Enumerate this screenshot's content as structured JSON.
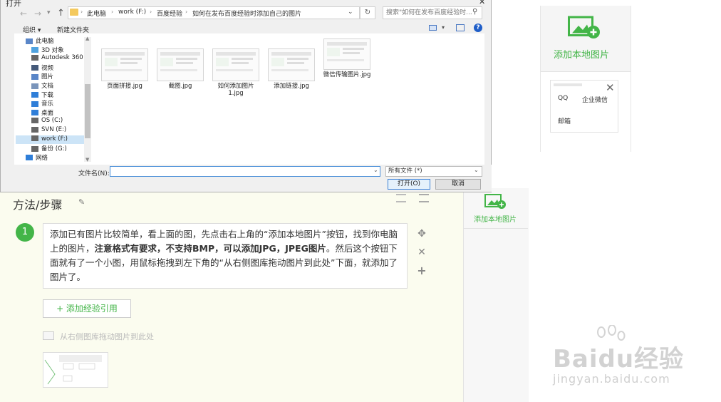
{
  "dialog": {
    "title": "打开",
    "close": "✕",
    "path": [
      "此电脑",
      "work (F:)",
      "百度经验",
      "如何在发布百度经验时添加自己的图片"
    ],
    "search_placeholder": "搜索\"如何在发布百度经验时...",
    "toolbar": {
      "organize": "组织 ▾",
      "new_folder": "新建文件夹"
    },
    "tree": [
      {
        "label": "此电脑",
        "icon": "computer-icon",
        "color": "#5a86c8"
      },
      {
        "label": "3D 对象",
        "icon": "cube-icon",
        "color": "#4fa3e0"
      },
      {
        "label": "Autodesk 360",
        "icon": "cloud-icon",
        "color": "#666"
      },
      {
        "label": "视频",
        "icon": "video-icon",
        "color": "#455a7a"
      },
      {
        "label": "图片",
        "icon": "picture-icon",
        "color": "#5a86c8"
      },
      {
        "label": "文档",
        "icon": "document-icon",
        "color": "#7a95bb"
      },
      {
        "label": "下载",
        "icon": "download-icon",
        "color": "#2f7ed8"
      },
      {
        "label": "音乐",
        "icon": "music-icon",
        "color": "#2f7ed8"
      },
      {
        "label": "桌面",
        "icon": "desktop-icon",
        "color": "#2f7ed8"
      },
      {
        "label": "OS (C:)",
        "icon": "drive-icon",
        "color": "#666"
      },
      {
        "label": "SVN (E:)",
        "icon": "drive-icon",
        "color": "#666"
      },
      {
        "label": "work (F:)",
        "icon": "drive-icon",
        "color": "#666"
      },
      {
        "label": "备份 (G:)",
        "icon": "drive-icon",
        "color": "#666"
      },
      {
        "label": "网络",
        "icon": "network-icon",
        "color": "#2f7ed8"
      }
    ],
    "files": [
      "页面拼接.jpg",
      "截图.jpg",
      "如何添加图片1.jpg",
      "添加链接.jpg",
      "微信传输图片.jpg"
    ],
    "filename_label": "文件名(N):",
    "filename_value": "",
    "filetype": "所有文件 (*)",
    "open_button": "打开(O)",
    "cancel_button": "取消"
  },
  "editor": {
    "section_title": "方法/步骤",
    "step_number": "1",
    "step_text_1": "添加已有图片比较简单，看上面的图，先点击右上角的“添加本地图片”按钮，找到你电脑上的图片，",
    "step_text_bold": "注意格式有要求，不支持BMP，可以添加JPG，JPEG图片",
    "step_text_2": "。然后这个按钮下面就有了一个小图，用鼠标拖拽到左下角的“从右侧图库拖动图片到此处”下面，就添加了图片了。",
    "add_ref_button": "+ 添加经验引用",
    "drop_hint": "从右侧图库拖动图片到此处"
  },
  "right_panel": {
    "add_image_label": "添加本地图片",
    "thumb_qq": "QQ",
    "thumb_wechat": "企业微信",
    "thumb_mail": "邮箱",
    "close": "✕"
  },
  "watermark": {
    "text": "Baidu经验",
    "url": "jingyan.baidu.com"
  },
  "colors": {
    "accent": "#43b548",
    "dialog_bg": "#f0f0f0",
    "editor_bg": "#fbfcef"
  }
}
